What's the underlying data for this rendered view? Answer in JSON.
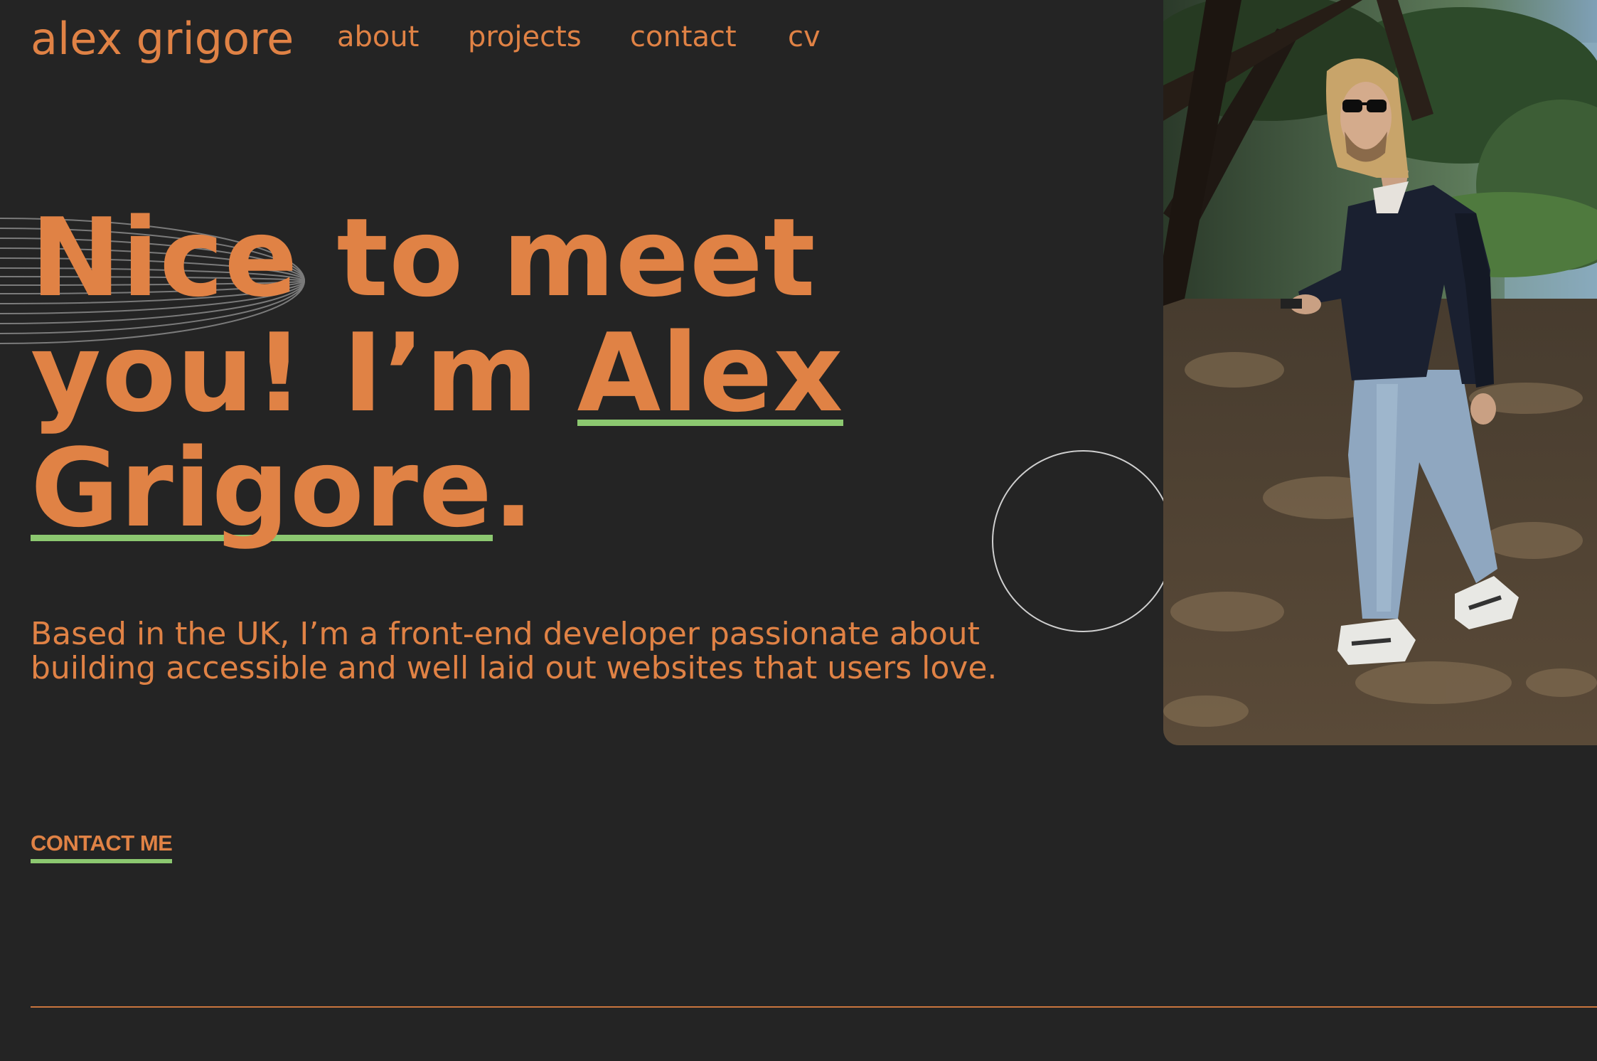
{
  "header": {
    "logo": "alex grigore",
    "nav": [
      {
        "label": "about"
      },
      {
        "label": "projects"
      },
      {
        "label": "contact"
      },
      {
        "label": "cv"
      }
    ]
  },
  "hero": {
    "title_part1": "Nice to meet",
    "title_part2": "you! I’m ",
    "title_name_first": "Alex",
    "title_name_last": "Grigore",
    "title_end": ".",
    "intro": "Based in the UK, I’m a front-end developer passionate about building accessible and well laid out websites that users love.",
    "cta": "CONTACT ME"
  },
  "colors": {
    "background": "#242424",
    "accent": "#e08245",
    "underline": "#8cc870"
  }
}
